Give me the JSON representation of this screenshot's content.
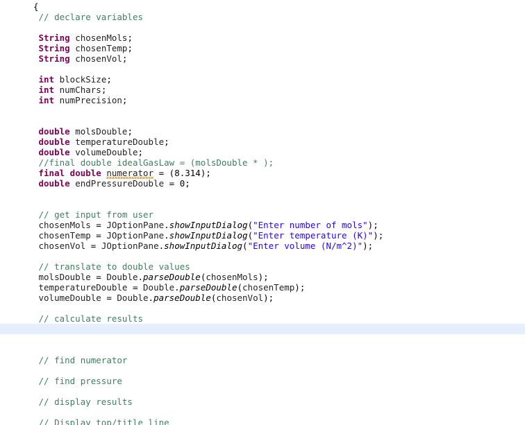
{
  "editor": {
    "name": "java-code-editor",
    "language": "Java",
    "background_color": "#ffffff",
    "highlight_color": "#e4eefd",
    "colors": {
      "keyword": "#7f0055",
      "comment": "#3f7f5f",
      "string": "#2a00ff",
      "identifier": "#222222",
      "plain": "#000000",
      "spellcheck_squiggle": "#d8a24a"
    },
    "highlighted_line_index": 31,
    "lines": [
      {
        "indent": 0,
        "tokens": [
          {
            "t": "pun",
            "v": "{"
          }
        ]
      },
      {
        "indent": 1,
        "tokens": [
          {
            "t": "cmt",
            "v": "// declare variables"
          }
        ]
      },
      {
        "indent": 0,
        "tokens": []
      },
      {
        "indent": 1,
        "tokens": [
          {
            "t": "kw",
            "v": "String"
          },
          {
            "t": "pun",
            "v": " "
          },
          {
            "t": "id",
            "v": "chosenMols"
          },
          {
            "t": "pun",
            "v": ";"
          }
        ]
      },
      {
        "indent": 1,
        "tokens": [
          {
            "t": "kw",
            "v": "String"
          },
          {
            "t": "pun",
            "v": " "
          },
          {
            "t": "id",
            "v": "chosenTemp"
          },
          {
            "t": "pun",
            "v": ";"
          }
        ]
      },
      {
        "indent": 1,
        "tokens": [
          {
            "t": "kw",
            "v": "String"
          },
          {
            "t": "pun",
            "v": " "
          },
          {
            "t": "id",
            "v": "chosenVol"
          },
          {
            "t": "pun",
            "v": ";"
          }
        ]
      },
      {
        "indent": 0,
        "tokens": []
      },
      {
        "indent": 1,
        "tokens": [
          {
            "t": "kw",
            "v": "int"
          },
          {
            "t": "pun",
            "v": " "
          },
          {
            "t": "id",
            "v": "blockSize"
          },
          {
            "t": "pun",
            "v": ";"
          }
        ]
      },
      {
        "indent": 1,
        "tokens": [
          {
            "t": "kw",
            "v": "int"
          },
          {
            "t": "pun",
            "v": " "
          },
          {
            "t": "id",
            "v": "numChars"
          },
          {
            "t": "pun",
            "v": ";"
          }
        ]
      },
      {
        "indent": 1,
        "tokens": [
          {
            "t": "kw",
            "v": "int"
          },
          {
            "t": "pun",
            "v": " "
          },
          {
            "t": "id",
            "v": "numPrecision"
          },
          {
            "t": "pun",
            "v": ";"
          }
        ]
      },
      {
        "indent": 0,
        "tokens": []
      },
      {
        "indent": 0,
        "tokens": []
      },
      {
        "indent": 1,
        "tokens": [
          {
            "t": "kw",
            "v": "double"
          },
          {
            "t": "pun",
            "v": " "
          },
          {
            "t": "id",
            "v": "molsDouble"
          },
          {
            "t": "pun",
            "v": ";"
          }
        ]
      },
      {
        "indent": 1,
        "tokens": [
          {
            "t": "kw",
            "v": "double"
          },
          {
            "t": "pun",
            "v": " "
          },
          {
            "t": "id",
            "v": "temperatureDouble"
          },
          {
            "t": "pun",
            "v": ";"
          }
        ]
      },
      {
        "indent": 1,
        "tokens": [
          {
            "t": "kw",
            "v": "double"
          },
          {
            "t": "pun",
            "v": " "
          },
          {
            "t": "id",
            "v": "volumeDouble"
          },
          {
            "t": "pun",
            "v": ";"
          }
        ]
      },
      {
        "indent": 1,
        "tokens": [
          {
            "t": "cmt",
            "v": "//final double idealGasLaw = (molsDouble * );"
          }
        ]
      },
      {
        "indent": 1,
        "tokens": [
          {
            "t": "kw",
            "v": "final"
          },
          {
            "t": "pun",
            "v": " "
          },
          {
            "t": "kw",
            "v": "double"
          },
          {
            "t": "pun",
            "v": " "
          },
          {
            "t": "id",
            "v": "numerator",
            "squiggle": true
          },
          {
            "t": "pun",
            "v": " = ("
          },
          {
            "t": "num",
            "v": "8.314"
          },
          {
            "t": "pun",
            "v": ");"
          }
        ]
      },
      {
        "indent": 1,
        "tokens": [
          {
            "t": "kw",
            "v": "double"
          },
          {
            "t": "pun",
            "v": " "
          },
          {
            "t": "id",
            "v": "endPressureDouble"
          },
          {
            "t": "pun",
            "v": " = "
          },
          {
            "t": "num",
            "v": "0"
          },
          {
            "t": "pun",
            "v": ";"
          }
        ]
      },
      {
        "indent": 0,
        "tokens": []
      },
      {
        "indent": 0,
        "tokens": []
      },
      {
        "indent": 1,
        "tokens": [
          {
            "t": "cmt",
            "v": "// get input from user"
          }
        ]
      },
      {
        "indent": 1,
        "tokens": [
          {
            "t": "id",
            "v": "chosenMols"
          },
          {
            "t": "pun",
            "v": " = "
          },
          {
            "t": "id",
            "v": "JOptionPane"
          },
          {
            "t": "pun",
            "v": "."
          },
          {
            "t": "mth",
            "v": "showInputDialog"
          },
          {
            "t": "pun",
            "v": "("
          },
          {
            "t": "str",
            "v": "\"Enter number of mols\""
          },
          {
            "t": "pun",
            "v": ");"
          }
        ]
      },
      {
        "indent": 1,
        "tokens": [
          {
            "t": "id",
            "v": "chosenTemp"
          },
          {
            "t": "pun",
            "v": " = "
          },
          {
            "t": "id",
            "v": "JOptionPane"
          },
          {
            "t": "pun",
            "v": "."
          },
          {
            "t": "mth",
            "v": "showInputDialog"
          },
          {
            "t": "pun",
            "v": "("
          },
          {
            "t": "str",
            "v": "\"Enter temperature (K)\""
          },
          {
            "t": "pun",
            "v": ");"
          }
        ]
      },
      {
        "indent": 1,
        "tokens": [
          {
            "t": "id",
            "v": "chosenVol"
          },
          {
            "t": "pun",
            "v": " = "
          },
          {
            "t": "id",
            "v": "JOptionPane"
          },
          {
            "t": "pun",
            "v": "."
          },
          {
            "t": "mth",
            "v": "showInputDialog"
          },
          {
            "t": "pun",
            "v": "("
          },
          {
            "t": "str",
            "v": "\"Enter volume (N/m^2)\""
          },
          {
            "t": "pun",
            "v": ");"
          }
        ]
      },
      {
        "indent": 0,
        "tokens": []
      },
      {
        "indent": 1,
        "tokens": [
          {
            "t": "cmt",
            "v": "// translate to double values"
          }
        ]
      },
      {
        "indent": 1,
        "tokens": [
          {
            "t": "id",
            "v": "molsDouble"
          },
          {
            "t": "pun",
            "v": " = "
          },
          {
            "t": "id",
            "v": "Double"
          },
          {
            "t": "pun",
            "v": "."
          },
          {
            "t": "mth",
            "v": "parseDouble"
          },
          {
            "t": "pun",
            "v": "("
          },
          {
            "t": "id",
            "v": "chosenMols"
          },
          {
            "t": "pun",
            "v": ");"
          }
        ]
      },
      {
        "indent": 1,
        "tokens": [
          {
            "t": "id",
            "v": "temperatureDouble"
          },
          {
            "t": "pun",
            "v": " = "
          },
          {
            "t": "id",
            "v": "Double"
          },
          {
            "t": "pun",
            "v": "."
          },
          {
            "t": "mth",
            "v": "parseDouble"
          },
          {
            "t": "pun",
            "v": "("
          },
          {
            "t": "id",
            "v": "chosenTemp"
          },
          {
            "t": "pun",
            "v": ");"
          }
        ]
      },
      {
        "indent": 1,
        "tokens": [
          {
            "t": "id",
            "v": "volumeDouble"
          },
          {
            "t": "pun",
            "v": " = "
          },
          {
            "t": "id",
            "v": "Double"
          },
          {
            "t": "pun",
            "v": "."
          },
          {
            "t": "mth",
            "v": "parseDouble"
          },
          {
            "t": "pun",
            "v": "("
          },
          {
            "t": "id",
            "v": "chosenVol"
          },
          {
            "t": "pun",
            "v": ");"
          }
        ]
      },
      {
        "indent": 0,
        "tokens": []
      },
      {
        "indent": 1,
        "tokens": [
          {
            "t": "cmt",
            "v": "// calculate results"
          }
        ]
      },
      {
        "indent": 0,
        "tokens": []
      },
      {
        "indent": 0,
        "tokens": []
      },
      {
        "indent": 0,
        "tokens": []
      },
      {
        "indent": 1,
        "tokens": [
          {
            "t": "cmt",
            "v": "// find numerator"
          }
        ]
      },
      {
        "indent": 0,
        "tokens": []
      },
      {
        "indent": 1,
        "tokens": [
          {
            "t": "cmt",
            "v": "// find pressure"
          }
        ]
      },
      {
        "indent": 0,
        "tokens": []
      },
      {
        "indent": 1,
        "tokens": [
          {
            "t": "cmt",
            "v": "// display results"
          }
        ]
      },
      {
        "indent": 0,
        "tokens": []
      },
      {
        "indent": 1,
        "tokens": [
          {
            "t": "cmt",
            "v": "// Display top/title line"
          }
        ]
      }
    ]
  }
}
